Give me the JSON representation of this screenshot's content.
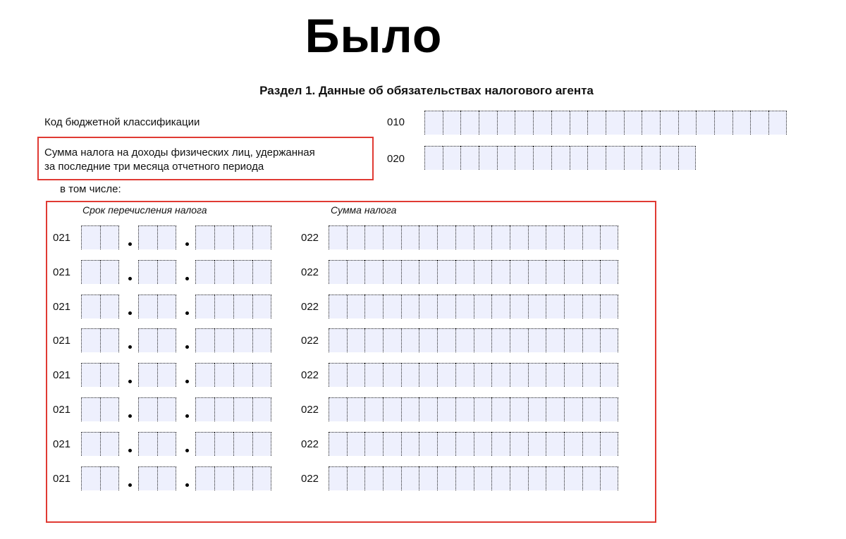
{
  "page": {
    "big_title": "Было",
    "section_title": "Раздел 1. Данные об обязательствах налогового агента"
  },
  "fields": {
    "kbk_label": "Код бюджетной классификации",
    "kbk_code": "010",
    "tax_sum_label_line1": "Сумма налога на доходы физических лиц, удержанная",
    "tax_sum_label_line2": "за последние три месяца отчетного периода",
    "tax_sum_code": "020",
    "including_label": "в том числе:"
  },
  "table": {
    "col_date_header": "Срок перечисления налога",
    "col_sum_header": "Сумма налога",
    "rows": [
      {
        "date_code": "021",
        "sum_code": "022"
      },
      {
        "date_code": "021",
        "sum_code": "022"
      },
      {
        "date_code": "021",
        "sum_code": "022"
      },
      {
        "date_code": "021",
        "sum_code": "022"
      },
      {
        "date_code": "021",
        "sum_code": "022"
      },
      {
        "date_code": "021",
        "sum_code": "022"
      },
      {
        "date_code": "021",
        "sum_code": "022"
      },
      {
        "date_code": "021",
        "sum_code": "022"
      }
    ]
  },
  "colors": {
    "highlight": "#e03a33",
    "cell_fill": "#eef0fd"
  }
}
